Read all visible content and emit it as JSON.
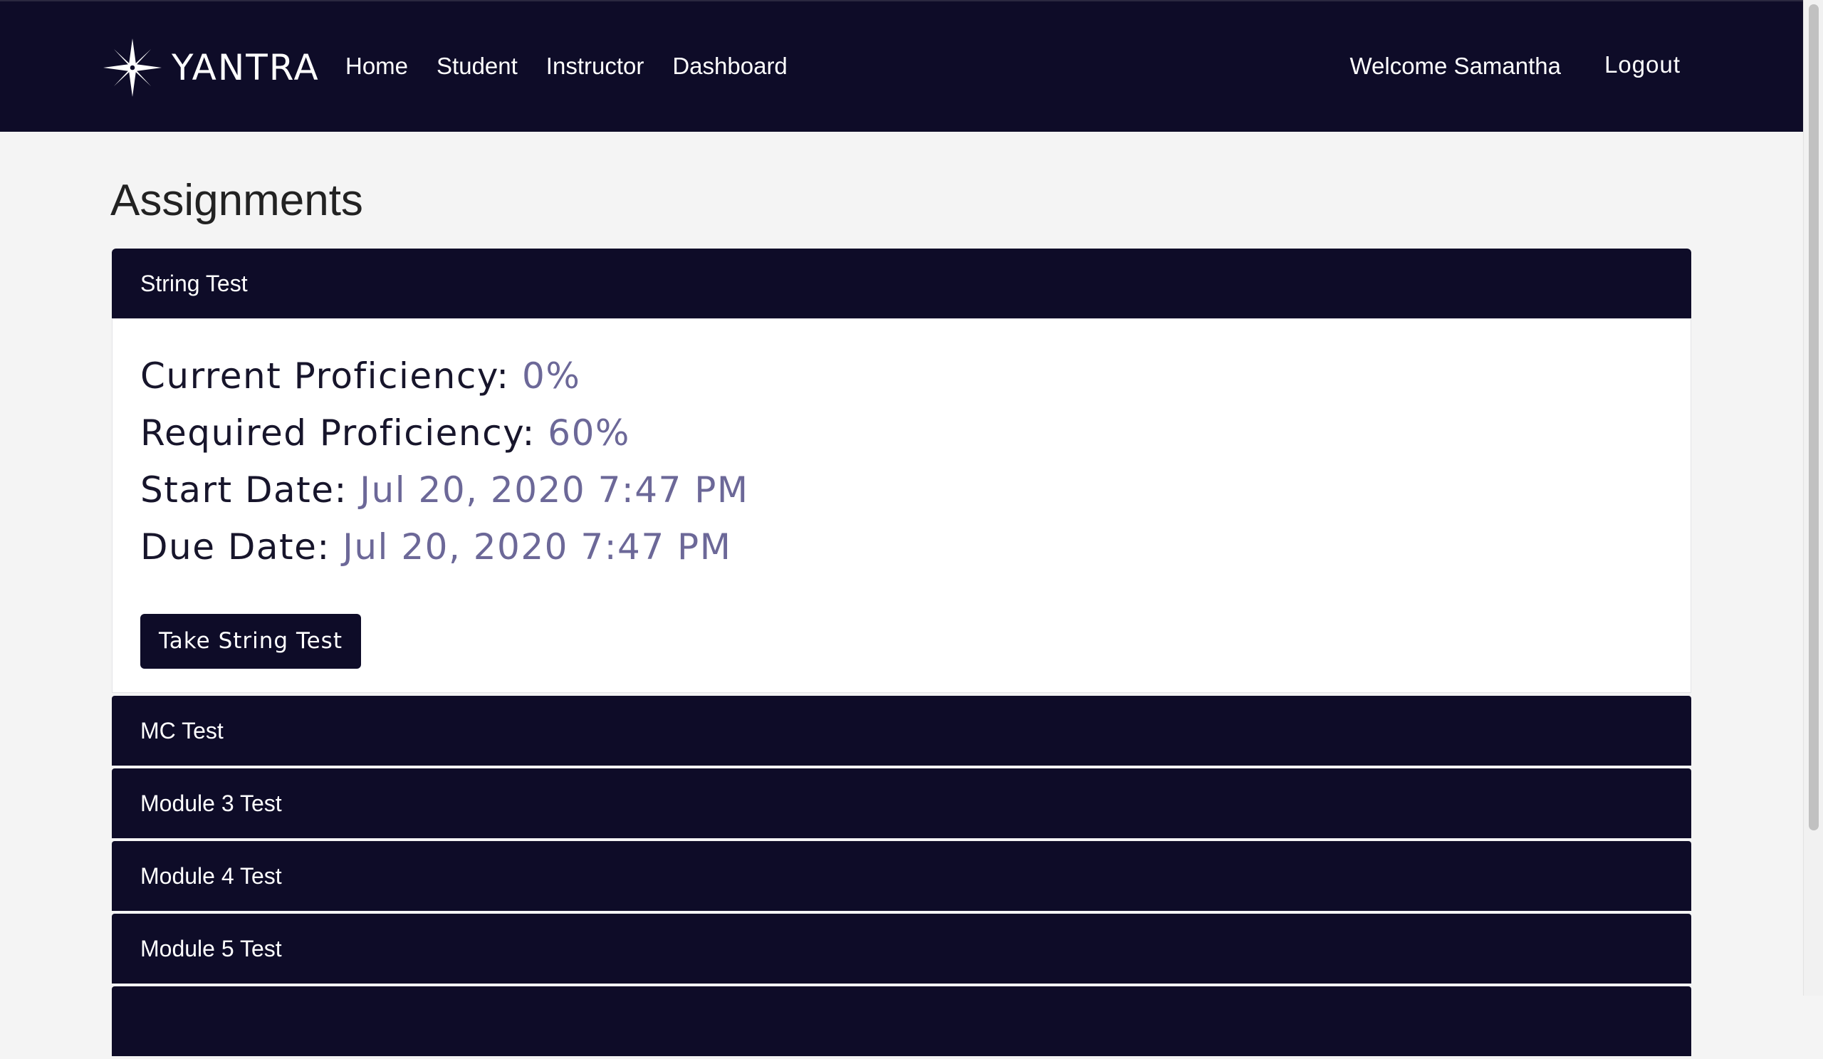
{
  "nav": {
    "brand": "YANTRA",
    "links": [
      "Home",
      "Student",
      "Instructor",
      "Dashboard"
    ],
    "welcome": "Welcome Samantha",
    "logout": "Logout"
  },
  "page": {
    "title": "Assignments"
  },
  "assignments": [
    {
      "title": "String Test",
      "expanded": true,
      "details": {
        "current_label": "Current Proficiency:",
        "current_value": "0%",
        "required_label": "Required Proficiency:",
        "required_value": "60%",
        "start_label": "Start Date:",
        "start_value": "Jul 20, 2020 7:47 PM",
        "due_label": "Due Date:",
        "due_value": "Jul 20, 2020 7:47 PM",
        "button_label": "Take String Test"
      }
    },
    {
      "title": "MC Test",
      "expanded": false
    },
    {
      "title": "Module 3 Test",
      "expanded": false
    },
    {
      "title": "Module 4 Test",
      "expanded": false
    },
    {
      "title": "Module 5 Test",
      "expanded": false
    },
    {
      "title": "",
      "expanded": false
    }
  ],
  "colors": {
    "navbar": "#0e0c28",
    "value_accent": "#6c6898",
    "page_bg": "#f4f4f4"
  },
  "icons": {
    "brand": "compass-star-icon"
  }
}
